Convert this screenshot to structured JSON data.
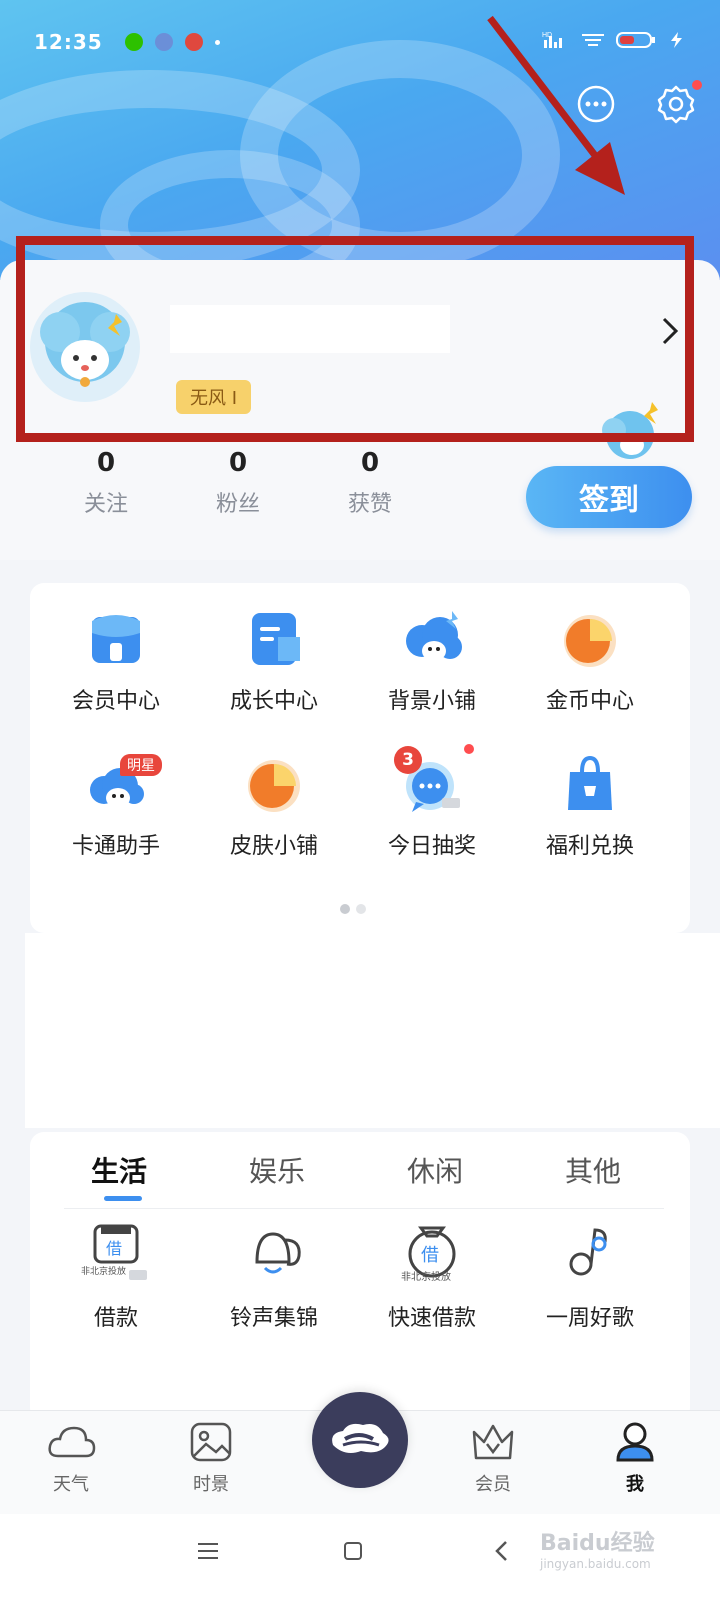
{
  "status_bar": {
    "time": "12:35",
    "network": "HD"
  },
  "profile": {
    "level_badge": "无风 Ⅰ",
    "stats": [
      {
        "value": "0",
        "label": "关注"
      },
      {
        "value": "0",
        "label": "粉丝"
      },
      {
        "value": "0",
        "label": "获赞"
      }
    ],
    "checkin_label": "签到"
  },
  "services": [
    {
      "label": "会员中心",
      "icon": "store-icon"
    },
    {
      "label": "成长中心",
      "icon": "document-icon"
    },
    {
      "label": "背景小铺",
      "icon": "cloud-mascot-icon"
    },
    {
      "label": "金币中心",
      "icon": "pie-coin-icon"
    },
    {
      "label": "卡通助手",
      "icon": "cartoon-cloud-icon",
      "badge": "明星"
    },
    {
      "label": "皮肤小铺",
      "icon": "pie-skin-icon"
    },
    {
      "label": "今日抽奖",
      "icon": "chat-bubble-icon",
      "badge": "3"
    },
    {
      "label": "福利兑换",
      "icon": "shopping-bag-icon"
    }
  ],
  "tabs": [
    "生活",
    "娱乐",
    "休闲",
    "其他"
  ],
  "life_items": [
    {
      "label": "借款",
      "icon": "loan-icon",
      "tag": "非北京投放"
    },
    {
      "label": "铃声集锦",
      "icon": "bell-icon"
    },
    {
      "label": "快速借款",
      "icon": "money-bag-icon",
      "tag": "非北京投放"
    },
    {
      "label": "一周好歌",
      "icon": "music-note-icon"
    }
  ],
  "bottom_nav": [
    {
      "label": "天气",
      "icon": "cloud-icon"
    },
    {
      "label": "时景",
      "icon": "image-icon"
    },
    {
      "label": "会员",
      "icon": "crown-v-icon"
    },
    {
      "label": "我",
      "icon": "person-icon"
    }
  ],
  "watermark": {
    "title": "Baidu经验",
    "subtitle": "jingyan.baidu.com"
  },
  "colors": {
    "accent": "#3d8fef",
    "highlight": "#b4211c",
    "badge": "#f7d16b"
  }
}
